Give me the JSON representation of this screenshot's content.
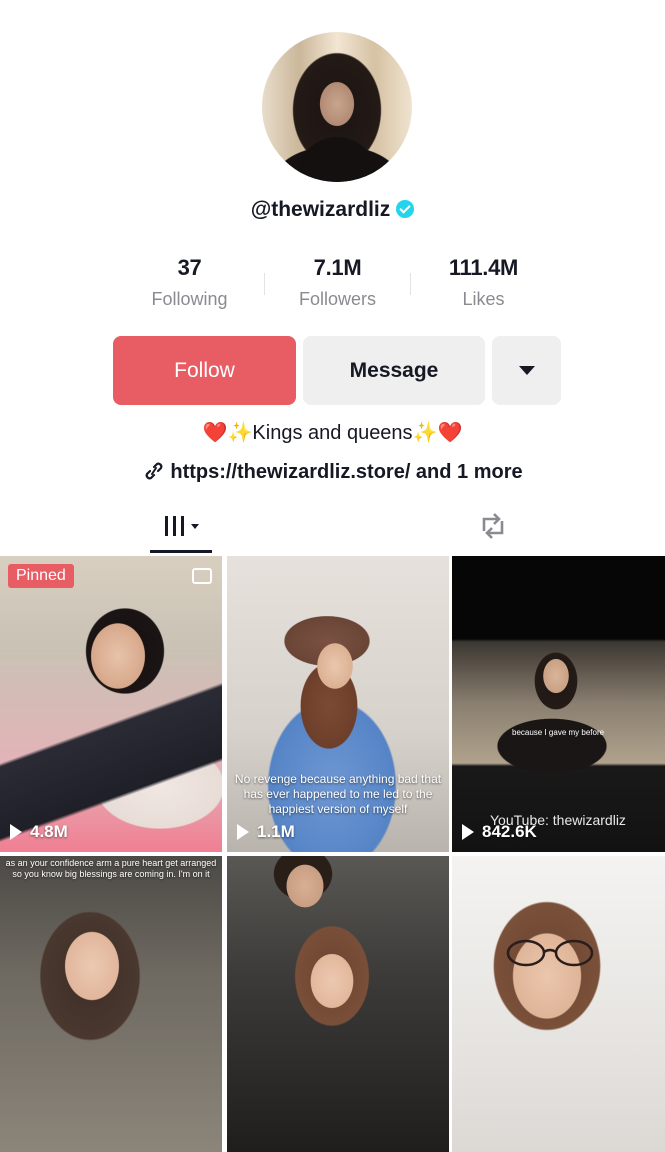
{
  "profile": {
    "username": "@thewizardliz",
    "verified": true,
    "stats": [
      {
        "value": "37",
        "label": "Following"
      },
      {
        "value": "7.1M",
        "label": "Followers"
      },
      {
        "value": "111.4M",
        "label": "Likes"
      }
    ],
    "buttons": {
      "follow": "Follow",
      "message": "Message"
    },
    "bio": "❤️✨Kings and queens✨❤️",
    "link": "https://thewizardliz.store/ and 1 more"
  },
  "tabs": {
    "active": "videos",
    "icons": [
      "videos-grid-icon",
      "repost-icon"
    ]
  },
  "videos": [
    {
      "views": "4.8M",
      "pinned_label": "Pinned",
      "type": "photo"
    },
    {
      "views": "1.1M",
      "caption": "No revenge because anything bad that has ever happened to me led to the happiest version of myself"
    },
    {
      "views": "842.6K",
      "overlay": "YouTube: thewizardliz",
      "subtitle": "because I gave my before"
    },
    {
      "caption": "as an your confidence arm a pure heart get arranged so you know big blessings are coming in. I'm on it"
    },
    {},
    {}
  ],
  "colors": {
    "accent": "#e85c64",
    "verified": "#20d5ec",
    "muted_text": "#8a8b91",
    "button_gray": "#efefef"
  }
}
